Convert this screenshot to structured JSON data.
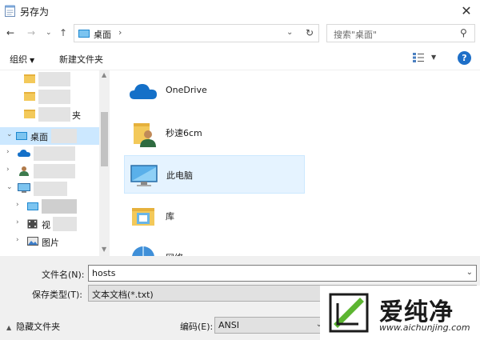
{
  "window": {
    "title": "另存为",
    "close_glyph": "✕",
    "icon": "notepad-icon"
  },
  "address_bar": {
    "back_glyph": "←",
    "forward_glyph": "→",
    "recent_glyph": "⌄",
    "up_glyph": "↑",
    "location": "桌面",
    "separator": "›",
    "dropdown_glyph": "⌄",
    "refresh_glyph": "↻",
    "search_placeholder": "搜索\"桌面\"",
    "search_glyph": "⚲"
  },
  "toolbar": {
    "organize": "组织",
    "organize_caret": "▼",
    "new_folder": "新建文件夹",
    "view_caret": "▼",
    "help": "?"
  },
  "nav_tree": {
    "items": [
      {
        "label": "",
        "icon": "folder-icon",
        "chevron": ""
      },
      {
        "label": "",
        "icon": "folder-icon",
        "chevron": ""
      },
      {
        "label": "夹",
        "icon": "folder-icon",
        "chevron": ""
      },
      {
        "label": "桌面",
        "icon": "desktop-icon",
        "chevron": "⌄",
        "selected": true
      },
      {
        "label": "",
        "icon": "onedrive-icon",
        "chevron": "›"
      },
      {
        "label": "",
        "icon": "user-icon",
        "chevron": "›"
      },
      {
        "label": "",
        "icon": "this-pc-icon",
        "chevron": "⌄"
      },
      {
        "label": "",
        "icon": "desktop-icon",
        "chevron": "›"
      },
      {
        "label": "视",
        "icon": "video-icon",
        "chevron": "›"
      },
      {
        "label": "图片",
        "icon": "pictures-icon",
        "chevron": "›"
      }
    ],
    "scroll_up": "▲",
    "scroll_down": "▼"
  },
  "content_items": [
    {
      "label": "OneDrive",
      "icon": "onedrive-icon"
    },
    {
      "label": "秒速6cm",
      "icon": "user-folder-icon"
    },
    {
      "label": "此电脑",
      "icon": "this-pc-icon",
      "selected": true
    },
    {
      "label": "库",
      "icon": "library-icon"
    },
    {
      "label": "网络",
      "icon": "network-icon"
    }
  ],
  "form": {
    "filename_label": "文件名(N):",
    "filename_value": "hosts",
    "filetype_label": "保存类型(T):",
    "filetype_value": "文本文档(*.txt)",
    "encoding_label": "编码(E):",
    "encoding_value": "ANSI",
    "dropdown_glyph": "⌄",
    "hide_folders": "隐藏文件夹",
    "hide_folders_caret": "▲"
  },
  "watermark": {
    "name": "爱纯净",
    "url": "www.aichunjing.com"
  },
  "colors": {
    "accent": "#1e6fc8",
    "selection": "#cce8ff",
    "folder": "#f3c95a"
  }
}
